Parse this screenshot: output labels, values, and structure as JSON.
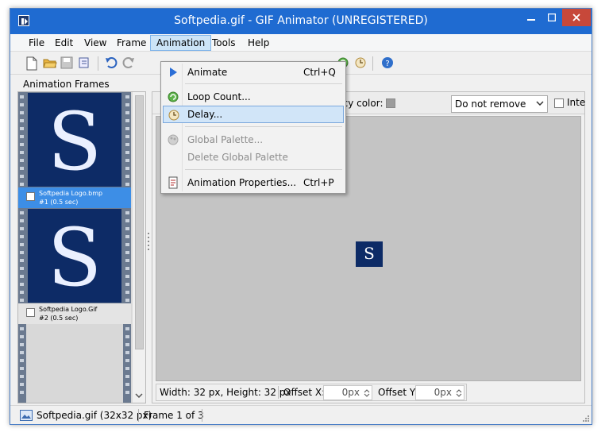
{
  "window": {
    "title": "Softpedia.gif - GIF Animator (UNREGISTERED)"
  },
  "menubar": {
    "items": [
      "File",
      "Edit",
      "View",
      "Frame",
      "Animation",
      "Tools",
      "Help"
    ],
    "active": "Animation"
  },
  "animation_menu": {
    "items": [
      {
        "label": "Animate",
        "shortcut": "Ctrl+Q",
        "icon": "play-icon",
        "enabled": true
      },
      {
        "label": "Loop Count...",
        "shortcut": "",
        "icon": "loop-icon",
        "enabled": true
      },
      {
        "label": "Delay...",
        "shortcut": "",
        "icon": "clock-icon",
        "enabled": true,
        "highlighted": true
      },
      {
        "label": "Global Palette...",
        "shortcut": "",
        "icon": "palette-icon",
        "enabled": false
      },
      {
        "label": "Delete Global Palette",
        "shortcut": "",
        "icon": "",
        "enabled": false
      },
      {
        "label": "Animation Properties...",
        "shortcut": "Ctrl+P",
        "icon": "properties-icon",
        "enabled": true
      }
    ]
  },
  "frames_panel": {
    "header": "Animation Frames",
    "frames": [
      {
        "name": "Softpedia Logo.bmp",
        "info": "#1 (0.5 sec)",
        "selected": true,
        "glyph": "S"
      },
      {
        "name": "Softpedia Logo.Gif",
        "info": "#2 (0.5 sec)",
        "selected": false,
        "glyph": "S"
      }
    ]
  },
  "main": {
    "transparency_label": "ncy color:",
    "disposal_value": "Do not remove",
    "interlaced_label": "Inte",
    "preview_glyph": "S",
    "size_text": "Width: 32 px, Height: 32 px",
    "offset_x_label": "Offset X:",
    "offset_x_value": "0px",
    "offset_y_label": "Offset Y:",
    "offset_y_value": "0px"
  },
  "status": {
    "file": "Softpedia.gif (32x32 px)",
    "frame": "Frame 1 of 3"
  },
  "colors": {
    "title_bar": "#1f6bd1",
    "close_button": "#c7483a",
    "thumb_bg": "#0d2b66",
    "selection": "#3d8ee6"
  }
}
